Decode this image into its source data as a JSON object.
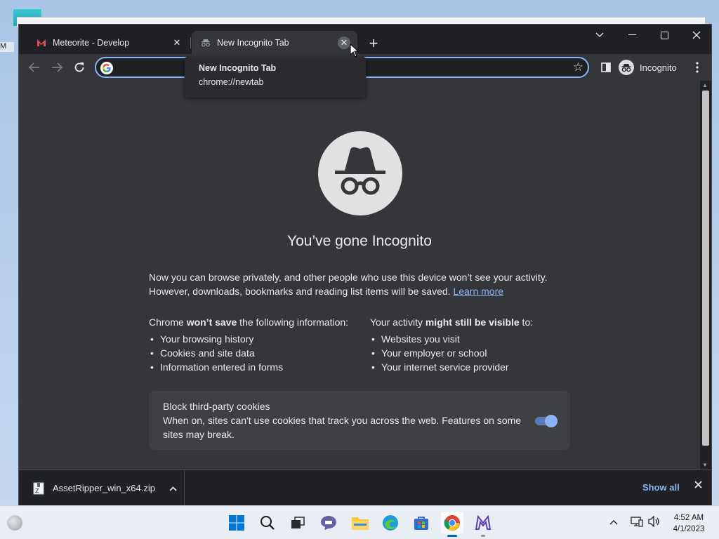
{
  "desktop": {
    "label_fragment": "M"
  },
  "browser": {
    "tabs": [
      {
        "title": "Meteorite - Develop",
        "active": false
      },
      {
        "title": "New Incognito Tab",
        "active": true
      }
    ],
    "new_tab": "+",
    "window_controls": {
      "tab_search": "⌄",
      "minimize": "—",
      "maximize": "☐",
      "close": "✕"
    },
    "toolbar": {
      "omnibox_value": "",
      "profile_label": "Incognito"
    },
    "tooltip": {
      "title": "New Incognito Tab",
      "url": "chrome://newtab"
    }
  },
  "page": {
    "heading": "You’ve gone Incognito",
    "intro_line1": "Now you can browse privately, and other people who use this device won’t see your activity.",
    "intro_line2": "However, downloads, bookmarks and reading list items will be saved.",
    "learn_more": "Learn more",
    "left_col": {
      "prefix": "Chrome ",
      "bold": "won’t save",
      "suffix": " the following information:",
      "items": [
        "Your browsing history",
        "Cookies and site data",
        "Information entered in forms"
      ]
    },
    "right_col": {
      "prefix": "Your activity ",
      "bold": "might still be visible",
      "suffix": " to:",
      "items": [
        "Websites you visit",
        "Your employer or school",
        "Your internet service provider"
      ]
    },
    "cookies": {
      "title": "Block third-party cookies",
      "description": "When on, sites can't use cookies that track you across the web. Features on some sites may break.",
      "enabled": true
    }
  },
  "downloads": {
    "file_name": "AssetRipper_win_x64.zip",
    "show_all": "Show all"
  },
  "taskbar": {
    "time": "4:52 AM",
    "date": "4/1/2023",
    "apps": [
      "start",
      "search",
      "task-view",
      "chat",
      "file-explorer",
      "edge",
      "store",
      "chrome",
      "meteorite"
    ]
  },
  "colors": {
    "accent": "#8ab4f8",
    "tabstrip": "#202124",
    "content": "#35363a"
  }
}
